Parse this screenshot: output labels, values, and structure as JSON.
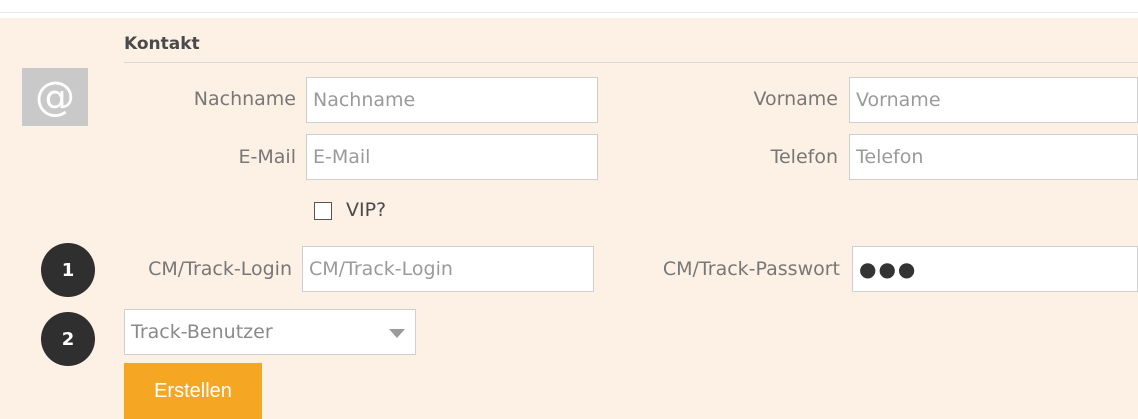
{
  "section": {
    "title": "Kontakt",
    "icon": "at-icon",
    "icon_glyph": "@"
  },
  "fields": {
    "nachname": {
      "label": "Nachname",
      "placeholder": "Nachname"
    },
    "vorname": {
      "label": "Vorname",
      "placeholder": "Vorname"
    },
    "email": {
      "label": "E-Mail",
      "placeholder": "E-Mail"
    },
    "telefon": {
      "label": "Telefon",
      "placeholder": "Telefon"
    },
    "vip": {
      "label": "VIP?",
      "checked": false
    },
    "cm_login": {
      "label": "CM/Track-Login",
      "placeholder": "CM/Track-Login"
    },
    "cm_passwort": {
      "label": "CM/Track-Passwort",
      "value": "●●●"
    },
    "track_user": {
      "selected": "Track-Benutzer"
    }
  },
  "badges": [
    "1",
    "2"
  ],
  "actions": {
    "create_label": "Erstellen"
  },
  "colors": {
    "panel_bg": "#fdf0e4",
    "button_bg": "#f5a623",
    "badge_bg": "#2f2f2f",
    "icon_box_bg": "#c9c9c9"
  }
}
